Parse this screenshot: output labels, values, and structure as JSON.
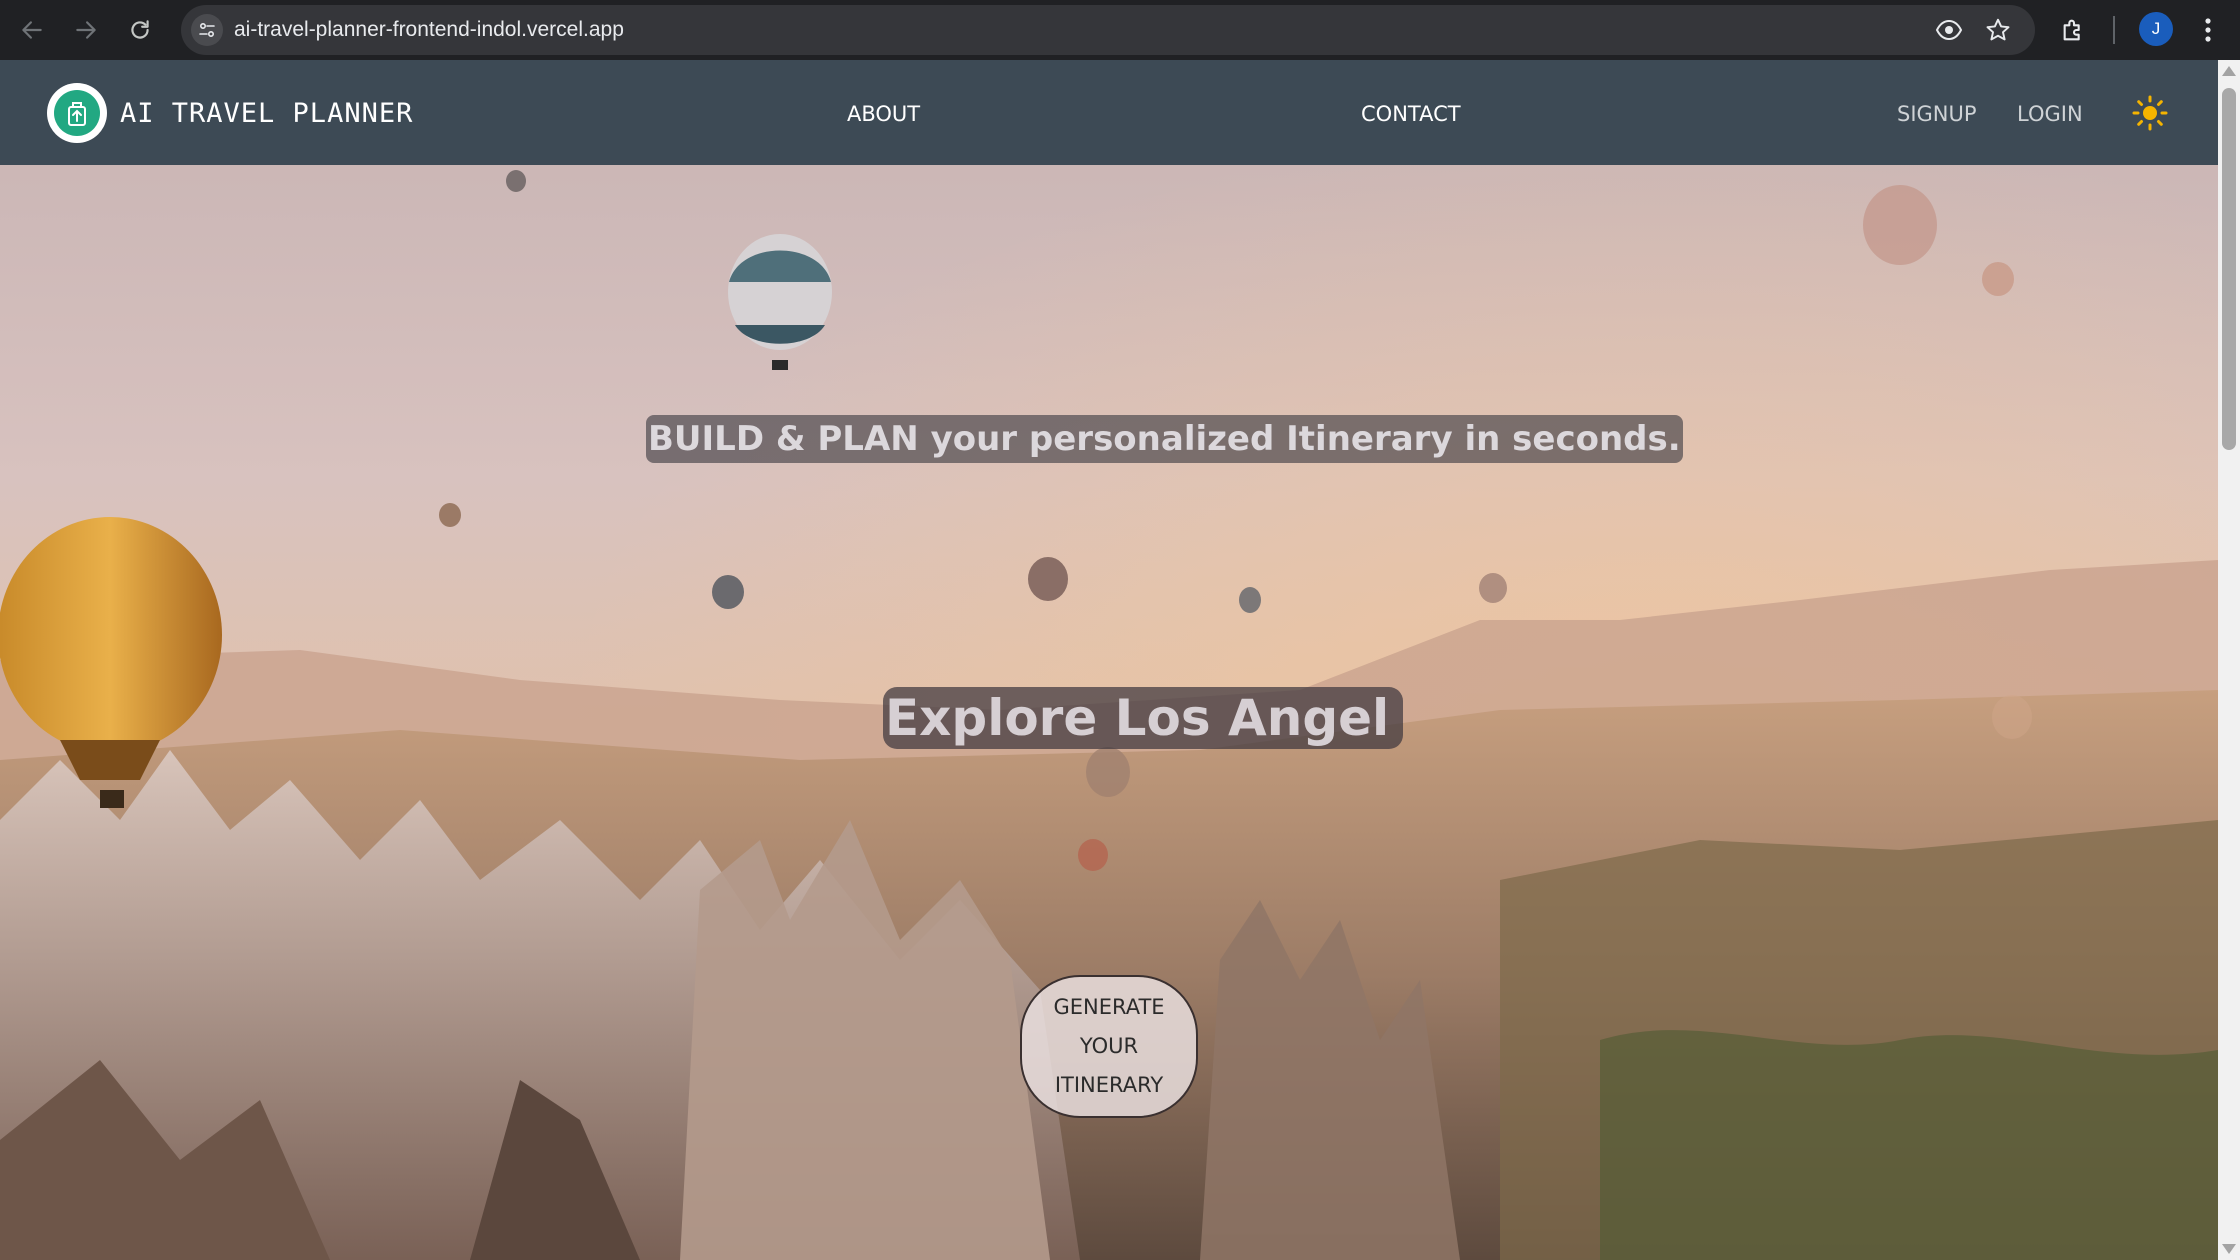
{
  "browser": {
    "url": "ai-travel-planner-frontend-indol.vercel.app",
    "profile_initial": "J",
    "icons": [
      "back-icon",
      "forward-icon",
      "reload-icon",
      "site-info-icon",
      "eye-icon",
      "star-icon",
      "extensions-icon",
      "more-menu-icon"
    ]
  },
  "header": {
    "brand": "AI TRAVEL PLANNER",
    "nav": {
      "about": "ABOUT",
      "contact": "CONTACT",
      "signup": "SIGNUP",
      "login": "LOGIN"
    },
    "theme_icon": "sun-icon",
    "logo_icon": "luggage-icon"
  },
  "hero": {
    "tagline": "BUILD & PLAN your personalized Itinerary in seconds.",
    "title": "Explore Los Angel",
    "cta_lines": [
      "GENERATE",
      "YOUR",
      "ITINERARY"
    ]
  },
  "colors": {
    "chrome_bg": "#202124",
    "header_bg": "#3d4a55",
    "logo_accent": "#22a882",
    "sun": "#f5b400"
  }
}
